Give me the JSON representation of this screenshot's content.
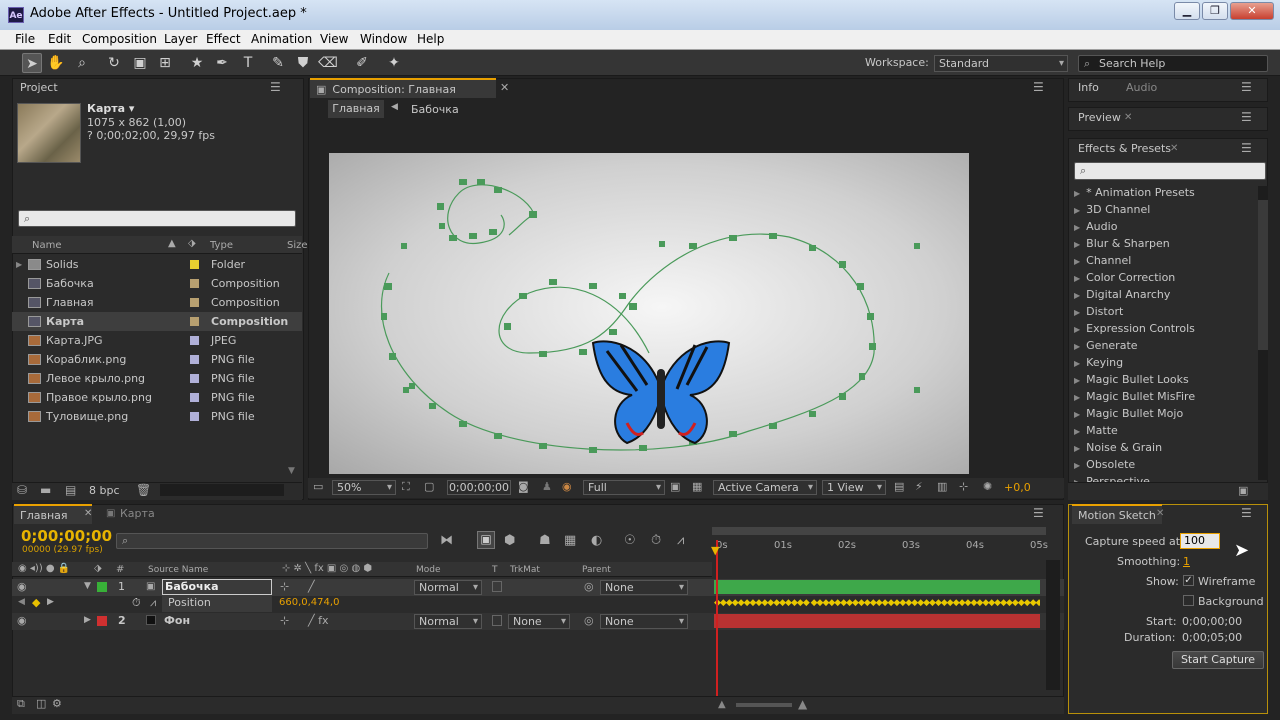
{
  "window": {
    "title": "Adobe After Effects - Untitled Project.aep *",
    "icon": "Ae",
    "minimize": "▁",
    "restore": "❐",
    "close": "✕"
  },
  "menu": [
    "File",
    "Edit",
    "Composition",
    "Layer",
    "Effect",
    "Animation",
    "View",
    "Window",
    "Help"
  ],
  "toolbar": {
    "workspace_label": "Workspace:",
    "workspace_value": "Standard",
    "search_placeholder": "Search Help"
  },
  "project": {
    "tab": "Project",
    "item_name": "Карта ▾",
    "item_dims": "1075 x 862 (1,00)",
    "item_dur": "? 0;00;02;00, 29,97 fps",
    "col_name": "Name",
    "col_type": "Type",
    "col_size": "Size",
    "rows": [
      {
        "name": "Solids",
        "type": "Folder",
        "label_color": "#e8d030",
        "icon": "folder-icon"
      },
      {
        "name": "Бабочка",
        "type": "Composition",
        "label_color": "#b8a070",
        "icon": "composition-icon"
      },
      {
        "name": "Главная",
        "type": "Composition",
        "label_color": "#b8a070",
        "icon": "composition-icon"
      },
      {
        "name": "Карта",
        "type": "Composition",
        "label_color": "#b8a070",
        "icon": "composition-icon"
      },
      {
        "name": "Карта.JPG",
        "type": "JPEG",
        "label_color": "#b0b0d8",
        "icon": "image-icon"
      },
      {
        "name": "Кораблик.png",
        "type": "PNG file",
        "label_color": "#b0b0d8",
        "icon": "png-icon"
      },
      {
        "name": "Левое крыло.png",
        "type": "PNG file",
        "label_color": "#b0b0d8",
        "icon": "png-icon"
      },
      {
        "name": "Правое крыло.png",
        "type": "PNG file",
        "label_color": "#b0b0d8",
        "icon": "png-icon"
      },
      {
        "name": "Туловище.png",
        "type": "PNG file",
        "label_color": "#b0b0d8",
        "icon": "png-icon"
      }
    ],
    "bpc": "8 bpc"
  },
  "comp": {
    "tab": "Composition: Главная",
    "crumb1": "Главная",
    "crumb2": "Бабочка",
    "zoom": "50%",
    "timecode": "0;00;00;00",
    "resolution": "Full",
    "camera": "Active Camera",
    "views": "1 View",
    "exposure": "+0,0"
  },
  "info": {
    "tab1": "Info",
    "tab2": "Audio"
  },
  "preview": {
    "tab": "Preview"
  },
  "effects": {
    "tab": "Effects & Presets",
    "items": [
      "* Animation Presets",
      "3D Channel",
      "Audio",
      "Blur & Sharpen",
      "Channel",
      "Color Correction",
      "Digital Anarchy",
      "Distort",
      "Expression Controls",
      "Generate",
      "Keying",
      "Magic Bullet Looks",
      "Magic Bullet MisFire",
      "Magic Bullet Mojo",
      "Matte",
      "Noise & Grain",
      "Obsolete",
      "Perspective"
    ]
  },
  "timeline": {
    "tab1": "Главная",
    "tab2": "Карта",
    "timecode": "0;00;00;00",
    "fps": "00000 (29.97 fps)",
    "col_source": "Source Name",
    "col_mode": "Mode",
    "col_t": "T",
    "col_trkmat": "TrkMat",
    "col_parent": "Parent",
    "ruler": [
      "0s",
      "01s",
      "02s",
      "03s",
      "04s",
      "05s"
    ],
    "layers": [
      {
        "num": "1",
        "name": "Бабочка",
        "color": "#38b038",
        "mode": "Normal",
        "trkmat": "",
        "parent": "None"
      },
      {
        "num": "2",
        "name": "Фон",
        "color": "#d03030",
        "mode": "Normal",
        "trkmat": "None",
        "parent": "None"
      }
    ],
    "prop_name": "Position",
    "prop_value": "660,0,474,0"
  },
  "motion_sketch": {
    "tab": "Motion Sketch",
    "capture_label": "Capture speed at:",
    "capture_value": "100",
    "smoothing_label": "Smoothing:",
    "smoothing_value": "1",
    "show_label": "Show:",
    "wireframe": "Wireframe",
    "background": "Background",
    "start_label": "Start:",
    "start_value": "0;00;00;00",
    "duration_label": "Duration:",
    "duration_value": "0;00;05;00",
    "button": "Start Capture"
  }
}
